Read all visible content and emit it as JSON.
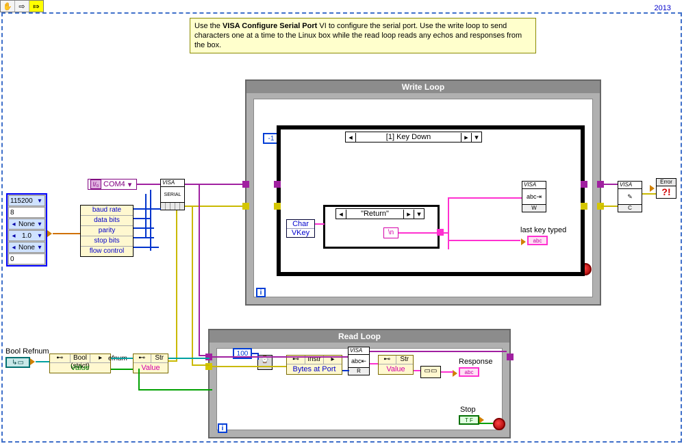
{
  "toolbar": {
    "hand": "✋",
    "arrow": "⇨",
    "highlight": "⤇"
  },
  "frame": {
    "year": "2013"
  },
  "note_parts": {
    "pre": "Use the ",
    "bold": "VISA Configure Serial Port",
    "post": " VI to configure the serial port. Use the write loop to send characters one at a time to the Linux box while the read loop reads any echos and responses from the box."
  },
  "visa_resource": {
    "value": "COM4",
    "prefix": "I/₀"
  },
  "serial_cfg": {
    "constants": {
      "baud": "115200",
      "data_bits": "8",
      "parity": "None",
      "stop_bits": "1.0",
      "flow": "None",
      "extra": "0"
    },
    "bundle": [
      "baud rate",
      "data bits",
      "parity",
      "stop bits",
      "flow control"
    ]
  },
  "write_loop": {
    "title": "Write Loop",
    "neg_one": "-1",
    "event_case": "[1] Key Down",
    "inner_case": "\"Return\"",
    "newline": "\\n",
    "event_data": [
      "Char",
      "VKey"
    ],
    "last_key_label": "last key typed",
    "visa_write": "W",
    "visa_close": "C"
  },
  "read_loop": {
    "title": "Read Loop",
    "wait_ms": "100",
    "prop_node_class": "Instr",
    "prop_node_prop": "Bytes at Port",
    "visa_read": "R",
    "str_propnode": {
      "class": "Str",
      "prop": "Value"
    },
    "response_label": "Response",
    "stop_label": "Stop"
  },
  "refnum_chain": {
    "label": "Bool Refnum",
    "bool_node": {
      "class": "Bool (strict)",
      "prop": "Value"
    },
    "suffix": "efnum",
    "str_node": {
      "class": "Str",
      "prop": "Value"
    }
  },
  "visa_nodes": {
    "serial": "SERIAL",
    "abc": "abc"
  }
}
